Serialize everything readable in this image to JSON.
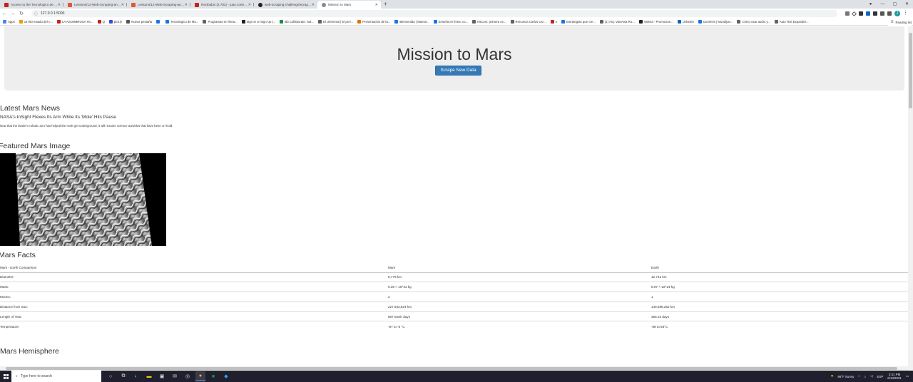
{
  "browser": {
    "tabs": [
      {
        "title": "Acceso to the Tecnologico de Monterrey",
        "favicon_color": "#c5221f",
        "active": false
      },
      {
        "title": "Lessons/12-Web-Scraping-and-Document-Databases",
        "favicon_color": "#e2582f",
        "active": false
      },
      {
        "title": "Lessons/12-Web-Scraping-and-Document-Databases",
        "favicon_color": "#e2582f",
        "active": false
      },
      {
        "title": "Recibidos (2.782) - juan.cortes@",
        "favicon_color": "#c5221f",
        "active": false
      },
      {
        "title": "web-scraping-challenge/scrape_mars.py",
        "favicon_color": "#222222",
        "active": false
      },
      {
        "title": "Mission to Mars",
        "favicon_color": "#8a8a8a",
        "active": true
      }
    ],
    "new_tab": "+",
    "window_controls": {
      "minimize": "—",
      "maximize": "▢",
      "close": "✕"
    },
    "url": "127.0.0.1:5000",
    "bookmarks": [
      {
        "label": "Apps",
        "color": "#4285f4"
      },
      {
        "label": "14750 estado del n...",
        "color": "#f29900"
      },
      {
        "label": "LA ASOMBROSA TE...",
        "color": "#c5221f"
      },
      {
        "label": "Q",
        "color": "#c5221f"
      },
      {
        "label": "plot.ly",
        "color": "#3d4cd9"
      },
      {
        "label": "Nueva pestaña",
        "color": "#555555"
      },
      {
        "label": "",
        "color": "#1a73e8"
      },
      {
        "label": "Tecnologico de Mo...",
        "color": "#1a73e8"
      },
      {
        "label": "Programas en línea...",
        "color": "#5f6368"
      },
      {
        "label": "Sign In or Sign Up |...",
        "color": "#202124"
      },
      {
        "label": "Bb Collaborate: Sal...",
        "color": "#1e8e3e"
      },
      {
        "label": "El Universal | El peri...",
        "color": "#5f6368"
      },
      {
        "label": "Presentación de la...",
        "color": "#e37400"
      },
      {
        "label": "Bienvenida | Maestr...",
        "color": "#1a73e8"
      },
      {
        "label": "Enseña en línea: co...",
        "color": "#1a73e8"
      },
      {
        "label": "KitCom: primera ce...",
        "color": "#5f6368"
      },
      {
        "label": "Renuncia Carlos Urz...",
        "color": "#5f6368"
      },
      {
        "label": "e",
        "color": "#c5221f"
      },
      {
        "label": "Estrategias que cre...",
        "color": "#1a73e8"
      },
      {
        "label": "(1) Arq. Vanessa Ro...",
        "color": "#5f6368"
      },
      {
        "label": "Valeria - Promocion...",
        "color": "#202124"
      },
      {
        "label": "LinkedIn",
        "color": "#0a66c2"
      },
      {
        "label": "Dominós | Mundijue...",
        "color": "#1a73e8"
      },
      {
        "label": "Cómo usar audio y...",
        "color": "#5f6368"
      },
      {
        "label": "Auto Text Expander...",
        "color": "#5f6368"
      }
    ],
    "reading_list": "Reading list"
  },
  "page": {
    "title": "Mission to Mars",
    "scrape_button": "Scrape New Data",
    "news_heading": "Latest Mars News",
    "news_title": "NASA's InSight Flexes Its Arm While Its 'Mole' Hits Pause",
    "news_paragraph": "Now that the lander's robotic arm has helped the mole get underground, it will resume science activities that have been on hold.",
    "featured_heading": "Featured Mars Image",
    "facts_heading": "Mars Facts",
    "facts_table": {
      "headers": [
        "Mars - Earth Comparison",
        "Mars",
        "Earth"
      ],
      "rows": [
        [
          "Diameter:",
          "6,779 km",
          "12,742 km"
        ],
        [
          "Mass:",
          "6.39 × 10^23 kg",
          "5.97 × 10^24 kg"
        ],
        [
          "Moons:",
          "2",
          "1"
        ],
        [
          "Distance from Sun:",
          "227,943,824 km",
          "149,598,262 km"
        ],
        [
          "Length of Year:",
          "687 Earth days",
          "365.24 days"
        ],
        [
          "Temperature:",
          "-87 to -5 °C",
          "-88 to 58°C"
        ]
      ]
    },
    "hemisphere_heading": "Mars Hemisphere"
  },
  "taskbar": {
    "search_placeholder": "Type here to search",
    "weather": "96°F  Sunny",
    "language": "ESP",
    "time": "2:41 PM",
    "date": "6/13/2021"
  }
}
